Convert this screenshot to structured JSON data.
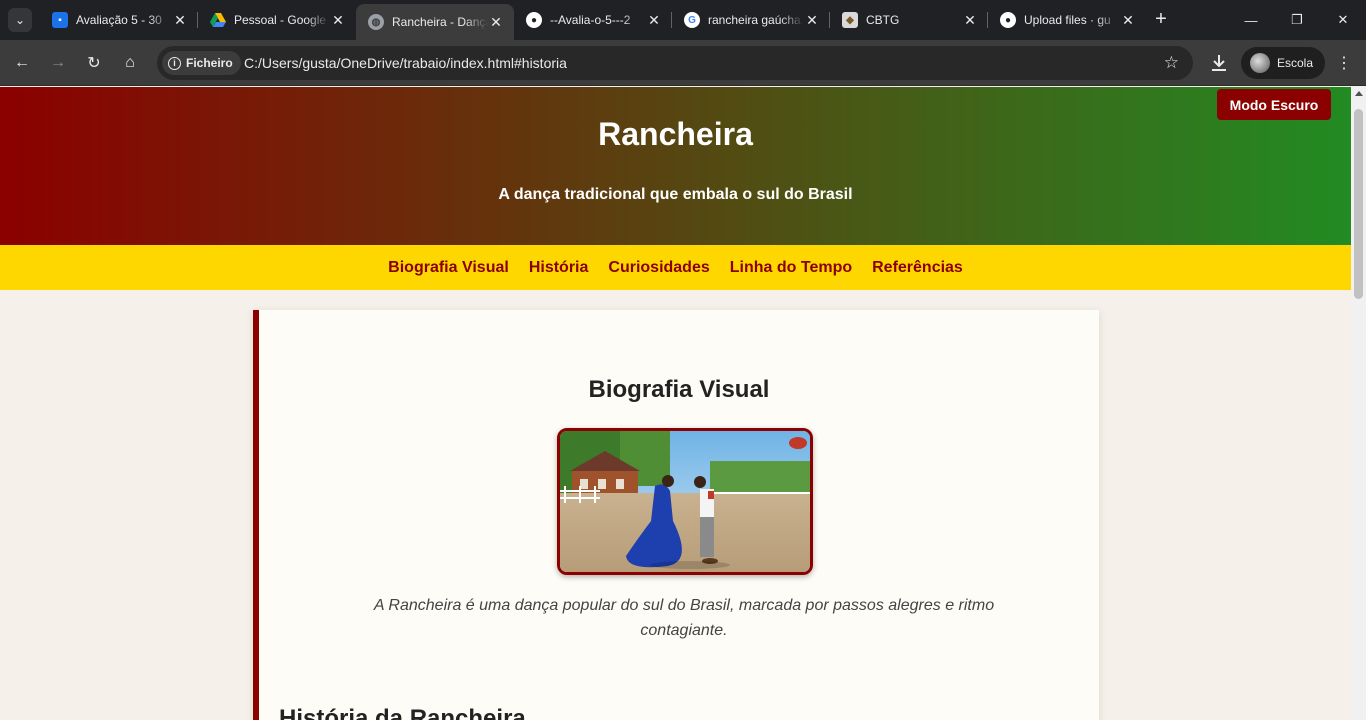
{
  "browser": {
    "tabs": [
      {
        "title": "Avaliação 5 - 30",
        "icon": "google-classroom-icon",
        "color": "#1a73e8"
      },
      {
        "title": "Pessoal - Google Drive",
        "icon": "google-drive-icon",
        "color": "#fbbc04"
      },
      {
        "title": "Rancheira - Dança",
        "icon": "globe-icon",
        "color": "#9aa0a6",
        "active": true
      },
      {
        "title": "--Avalia-o-5---2",
        "icon": "github-icon",
        "color": "#ffffff"
      },
      {
        "title": "rancheira gaúcha",
        "icon": "google-icon",
        "color": "#4285f4"
      },
      {
        "title": "CBTG",
        "icon": "cbtg-icon",
        "color": "#d9d9d9"
      },
      {
        "title": "Upload files · gu",
        "icon": "github-icon",
        "color": "#ffffff"
      }
    ],
    "site_chip": "Ficheiro",
    "url": "C:/Users/gusta/OneDrive/trabaio/index.html#historia",
    "profile_name": "Escola"
  },
  "page": {
    "dark_mode_label": "Modo Escuro",
    "title": "Rancheira",
    "subtitle": "A dança tradicional que embala o sul do Brasil",
    "nav": [
      "Biografia Visual",
      "História",
      "Curiosidades",
      "Linha do Tempo",
      "Referências"
    ],
    "section_title": "Biografia Visual",
    "caption": "A Rancheira é uma dança popular do sul do Brasil, marcada por passos alegres e ritmo contagiante.",
    "next_section_title": "História da Rancheira",
    "colors": {
      "red": "#8b0000",
      "green": "#228b22",
      "gold": "#ffd700"
    }
  }
}
